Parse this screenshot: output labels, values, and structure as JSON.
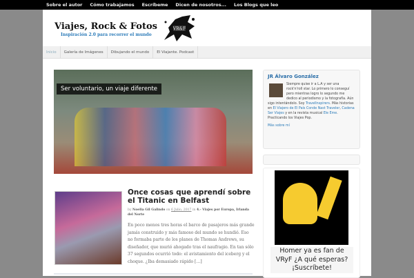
{
  "topbar": [
    "Sobre el autor",
    "Cómo trabajamos",
    "Escríbeme",
    "Dicen de nosotros...",
    "Los Blogs que leo"
  ],
  "site": {
    "title": "Viajes, Rock & Fotos",
    "tagline": "Inspiración 2.0 para recorrer el mundo",
    "logo_text": "VR&F"
  },
  "nav": [
    "Inicio",
    "Galería de Imágenes",
    "Dibujando el mundo",
    "El Viajante. Podcast"
  ],
  "featured": {
    "caption": "Ser voluntario, un viaje diferente"
  },
  "post": {
    "title": "Once cosas que aprendí sobre el Titanic en Belfast",
    "by": "by",
    "author": "Noelia Gil Galindo",
    "on": "on",
    "date": "6 Julio, 2017",
    "in": "in",
    "categories": "4.- Viajes por Europa, Irlanda del Norte",
    "excerpt": "En poco menos tres horas el barco de pasajeros más grande jamás construido y más famoso del mundo se hundió. Eso no formaba parte de los planes de Thomas Andrews, su diseñador, que murió ahogado tras el naufragio. En tan sólo 37 segundos ocurrió todo: el avistamiento del iceberg y el choque. ¿Iba demasiado rápido […]"
  },
  "about": {
    "title": "JR Álvaro González",
    "text1": "Siempre quise ir a L.A y ser una rock'n'roll star. Lo primero lo conseguí pero mientras logro lo segundo me dedico al periodismo y la fotografía. Aún sigo intentándolo. Soy ",
    "link1": "TravelInspirers",
    "text2": ". Más historias en ",
    "link2": "El Viajero de El País",
    "text3": " ",
    "link3": "Conde Nast Traveler",
    "text4": ", ",
    "link4": "Cadena Ser Viajes",
    "text5": " y en la revista musical ",
    "link5": "Ele Eme",
    "text6": ". Practicando los Viajes Pop.",
    "more": "Más sobre mí"
  },
  "homer": {
    "caption": "Homer ya es fan de VRyF ¿A qué esperas? ¡Suscríbete!"
  }
}
